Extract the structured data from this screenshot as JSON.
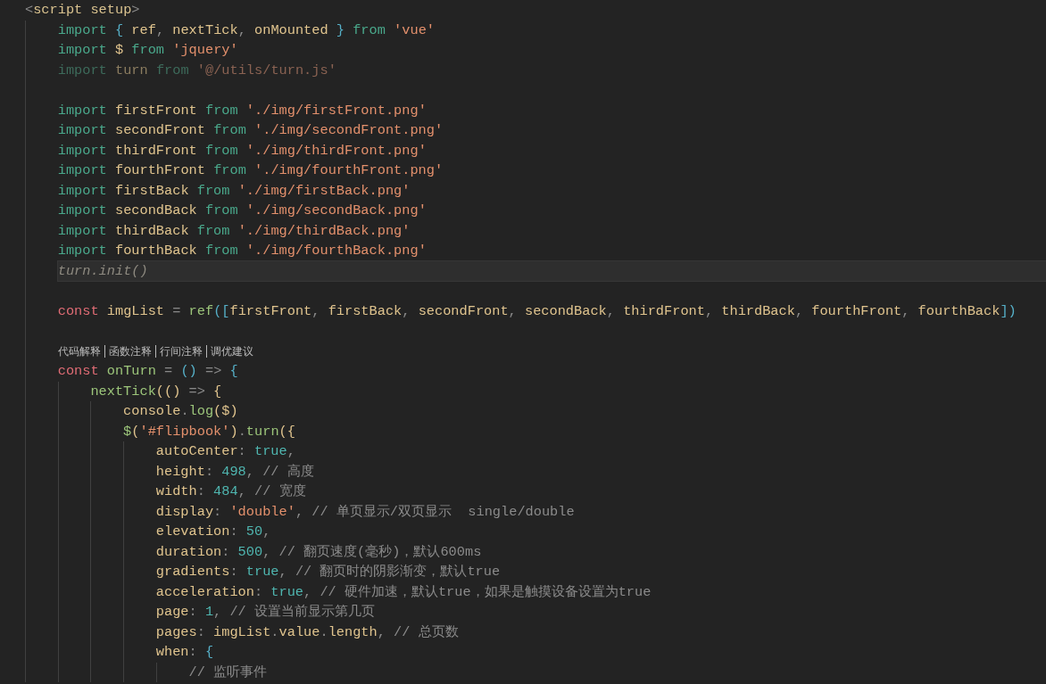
{
  "editor": {
    "lines": [
      {
        "kind": "code",
        "current": false,
        "tokens": [
          {
            "kind": "punct",
            "text": "<"
          },
          {
            "kind": "tag",
            "text": "script setup"
          },
          {
            "kind": "punct",
            "text": ">"
          }
        ],
        "children": [
          {
            "kind": "code",
            "current": false,
            "tokens": [
              {
                "kind": "keyword",
                "text": "import "
              },
              {
                "kind": "brace",
                "text": "{ "
              },
              {
                "kind": "ident",
                "text": "ref"
              },
              {
                "kind": "punct",
                "text": ", "
              },
              {
                "kind": "ident",
                "text": "nextTick"
              },
              {
                "kind": "punct",
                "text": ", "
              },
              {
                "kind": "ident",
                "text": "onMounted "
              },
              {
                "kind": "brace",
                "text": "} "
              },
              {
                "kind": "keyword",
                "text": "from "
              },
              {
                "kind": "string",
                "text": "'vue'"
              }
            ]
          },
          {
            "kind": "code",
            "current": false,
            "tokens": [
              {
                "kind": "keyword",
                "text": "import "
              },
              {
                "kind": "ident",
                "text": "$ "
              },
              {
                "kind": "keyword",
                "text": "from "
              },
              {
                "kind": "string",
                "text": "'jquery'"
              }
            ]
          },
          {
            "kind": "code",
            "current": false,
            "tokens": [
              {
                "kind": "keyword_faded",
                "text": "import "
              },
              {
                "kind": "ident_faded",
                "text": "turn "
              },
              {
                "kind": "keyword_faded",
                "text": "from "
              },
              {
                "kind": "string_faded",
                "text": "'@/utils/turn.js'"
              }
            ]
          },
          {
            "kind": "blank"
          },
          {
            "kind": "code",
            "current": false,
            "tokens": [
              {
                "kind": "keyword",
                "text": "import "
              },
              {
                "kind": "ident",
                "text": "firstFront "
              },
              {
                "kind": "keyword",
                "text": "from "
              },
              {
                "kind": "string",
                "text": "'./img/firstFront.png'"
              }
            ]
          },
          {
            "kind": "code",
            "current": false,
            "tokens": [
              {
                "kind": "keyword",
                "text": "import "
              },
              {
                "kind": "ident",
                "text": "secondFront "
              },
              {
                "kind": "keyword",
                "text": "from "
              },
              {
                "kind": "string",
                "text": "'./img/secondFront.png'"
              }
            ]
          },
          {
            "kind": "code",
            "current": false,
            "tokens": [
              {
                "kind": "keyword",
                "text": "import "
              },
              {
                "kind": "ident",
                "text": "thirdFront "
              },
              {
                "kind": "keyword",
                "text": "from "
              },
              {
                "kind": "string",
                "text": "'./img/thirdFront.png'"
              }
            ]
          },
          {
            "kind": "code",
            "current": false,
            "tokens": [
              {
                "kind": "keyword",
                "text": "import "
              },
              {
                "kind": "ident",
                "text": "fourthFront "
              },
              {
                "kind": "keyword",
                "text": "from "
              },
              {
                "kind": "string",
                "text": "'./img/fourthFront.png'"
              }
            ]
          },
          {
            "kind": "code",
            "current": false,
            "tokens": [
              {
                "kind": "keyword",
                "text": "import "
              },
              {
                "kind": "ident",
                "text": "firstBack "
              },
              {
                "kind": "keyword",
                "text": "from "
              },
              {
                "kind": "string",
                "text": "'./img/firstBack.png'"
              }
            ]
          },
          {
            "kind": "code",
            "current": false,
            "tokens": [
              {
                "kind": "keyword",
                "text": "import "
              },
              {
                "kind": "ident",
                "text": "secondBack "
              },
              {
                "kind": "keyword",
                "text": "from "
              },
              {
                "kind": "string",
                "text": "'./img/secondBack.png'"
              }
            ]
          },
          {
            "kind": "code",
            "current": false,
            "tokens": [
              {
                "kind": "keyword",
                "text": "import "
              },
              {
                "kind": "ident",
                "text": "thirdBack "
              },
              {
                "kind": "keyword",
                "text": "from "
              },
              {
                "kind": "string",
                "text": "'./img/thirdBack.png'"
              }
            ]
          },
          {
            "kind": "code",
            "current": false,
            "tokens": [
              {
                "kind": "keyword",
                "text": "import "
              },
              {
                "kind": "ident",
                "text": "fourthBack "
              },
              {
                "kind": "keyword",
                "text": "from "
              },
              {
                "kind": "string",
                "text": "'./img/fourthBack.png'"
              }
            ]
          },
          {
            "kind": "code",
            "current": true,
            "tokens": [
              {
                "kind": "italic",
                "text": "turn.init()"
              }
            ]
          },
          {
            "kind": "blank"
          },
          {
            "kind": "code",
            "current": false,
            "tokens": [
              {
                "kind": "storage",
                "text": "const "
              },
              {
                "kind": "ident",
                "text": "imgList "
              },
              {
                "kind": "punct",
                "text": "= "
              },
              {
                "kind": "function",
                "text": "ref"
              },
              {
                "kind": "brace",
                "text": "(["
              },
              {
                "kind": "ident",
                "text": "firstFront"
              },
              {
                "kind": "punct",
                "text": ", "
              },
              {
                "kind": "ident",
                "text": "firstBack"
              },
              {
                "kind": "punct",
                "text": ", "
              },
              {
                "kind": "ident",
                "text": "secondFront"
              },
              {
                "kind": "punct",
                "text": ", "
              },
              {
                "kind": "ident",
                "text": "secondBack"
              },
              {
                "kind": "punct",
                "text": ", "
              },
              {
                "kind": "ident",
                "text": "thirdFront"
              },
              {
                "kind": "punct",
                "text": ", "
              },
              {
                "kind": "ident",
                "text": "thirdBack"
              },
              {
                "kind": "punct",
                "text": ", "
              },
              {
                "kind": "ident",
                "text": "fourthFront"
              },
              {
                "kind": "punct",
                "text": ", "
              },
              {
                "kind": "ident",
                "text": "fourthBack"
              },
              {
                "kind": "brace",
                "text": "])"
              }
            ]
          },
          {
            "kind": "blank"
          },
          {
            "kind": "codelens",
            "links": [
              "代码解释",
              "函数注释",
              "行间注释",
              "调优建议"
            ]
          },
          {
            "kind": "code",
            "current": false,
            "tokens": [
              {
                "kind": "storage",
                "text": "const "
              },
              {
                "kind": "function",
                "text": "onTurn "
              },
              {
                "kind": "punct",
                "text": "= "
              },
              {
                "kind": "brace",
                "text": "() "
              },
              {
                "kind": "punct",
                "text": "=> "
              },
              {
                "kind": "brace",
                "text": "{"
              }
            ],
            "children": [
              {
                "kind": "code",
                "current": false,
                "tokens": [
                  {
                    "kind": "function",
                    "text": "nextTick"
                  },
                  {
                    "kind": "paren",
                    "text": "(() "
                  },
                  {
                    "kind": "punct",
                    "text": "=> "
                  },
                  {
                    "kind": "paren",
                    "text": "{"
                  }
                ],
                "children": [
                  {
                    "kind": "code",
                    "current": false,
                    "tokens": [
                      {
                        "kind": "ident",
                        "text": "console"
                      },
                      {
                        "kind": "punct",
                        "text": "."
                      },
                      {
                        "kind": "function",
                        "text": "log"
                      },
                      {
                        "kind": "paren",
                        "text": "($)"
                      }
                    ]
                  },
                  {
                    "kind": "code",
                    "current": false,
                    "tokens": [
                      {
                        "kind": "function",
                        "text": "$"
                      },
                      {
                        "kind": "paren",
                        "text": "("
                      },
                      {
                        "kind": "string",
                        "text": "'#flipbook'"
                      },
                      {
                        "kind": "paren",
                        "text": ")"
                      },
                      {
                        "kind": "punct",
                        "text": "."
                      },
                      {
                        "kind": "function",
                        "text": "turn"
                      },
                      {
                        "kind": "paren",
                        "text": "({"
                      }
                    ],
                    "children": [
                      {
                        "kind": "code",
                        "current": false,
                        "tokens": [
                          {
                            "kind": "property",
                            "text": "autoCenter"
                          },
                          {
                            "kind": "punct",
                            "text": ": "
                          },
                          {
                            "kind": "constant",
                            "text": "true"
                          },
                          {
                            "kind": "punct",
                            "text": ","
                          }
                        ]
                      },
                      {
                        "kind": "code",
                        "current": false,
                        "tokens": [
                          {
                            "kind": "property",
                            "text": "height"
                          },
                          {
                            "kind": "punct",
                            "text": ": "
                          },
                          {
                            "kind": "constant",
                            "text": "498"
                          },
                          {
                            "kind": "punct",
                            "text": ", "
                          },
                          {
                            "kind": "comment",
                            "text": "// 高度"
                          }
                        ]
                      },
                      {
                        "kind": "code",
                        "current": false,
                        "tokens": [
                          {
                            "kind": "property",
                            "text": "width"
                          },
                          {
                            "kind": "punct",
                            "text": ": "
                          },
                          {
                            "kind": "constant",
                            "text": "484"
                          },
                          {
                            "kind": "punct",
                            "text": ", "
                          },
                          {
                            "kind": "comment",
                            "text": "// 宽度"
                          }
                        ]
                      },
                      {
                        "kind": "code",
                        "current": false,
                        "tokens": [
                          {
                            "kind": "property",
                            "text": "display"
                          },
                          {
                            "kind": "punct",
                            "text": ": "
                          },
                          {
                            "kind": "string",
                            "text": "'double'"
                          },
                          {
                            "kind": "punct",
                            "text": ", "
                          },
                          {
                            "kind": "comment",
                            "text": "// 单页显示/双页显示  single/double"
                          }
                        ]
                      },
                      {
                        "kind": "code",
                        "current": false,
                        "tokens": [
                          {
                            "kind": "property",
                            "text": "elevation"
                          },
                          {
                            "kind": "punct",
                            "text": ": "
                          },
                          {
                            "kind": "constant",
                            "text": "50"
                          },
                          {
                            "kind": "punct",
                            "text": ","
                          }
                        ]
                      },
                      {
                        "kind": "code",
                        "current": false,
                        "tokens": [
                          {
                            "kind": "property",
                            "text": "duration"
                          },
                          {
                            "kind": "punct",
                            "text": ": "
                          },
                          {
                            "kind": "constant",
                            "text": "500"
                          },
                          {
                            "kind": "punct",
                            "text": ", "
                          },
                          {
                            "kind": "comment",
                            "text": "// 翻页速度(毫秒)，默认600ms"
                          }
                        ]
                      },
                      {
                        "kind": "code",
                        "current": false,
                        "tokens": [
                          {
                            "kind": "property",
                            "text": "gradients"
                          },
                          {
                            "kind": "punct",
                            "text": ": "
                          },
                          {
                            "kind": "constant",
                            "text": "true"
                          },
                          {
                            "kind": "punct",
                            "text": ", "
                          },
                          {
                            "kind": "comment",
                            "text": "// 翻页时的阴影渐变，默认true"
                          }
                        ]
                      },
                      {
                        "kind": "code",
                        "current": false,
                        "tokens": [
                          {
                            "kind": "property",
                            "text": "acceleration"
                          },
                          {
                            "kind": "punct",
                            "text": ": "
                          },
                          {
                            "kind": "constant",
                            "text": "true"
                          },
                          {
                            "kind": "punct",
                            "text": ", "
                          },
                          {
                            "kind": "comment",
                            "text": "// 硬件加速，默认true，如果是触摸设备设置为true"
                          }
                        ]
                      },
                      {
                        "kind": "code",
                        "current": false,
                        "tokens": [
                          {
                            "kind": "property",
                            "text": "page"
                          },
                          {
                            "kind": "punct",
                            "text": ": "
                          },
                          {
                            "kind": "constant",
                            "text": "1"
                          },
                          {
                            "kind": "punct",
                            "text": ", "
                          },
                          {
                            "kind": "comment",
                            "text": "// 设置当前显示第几页"
                          }
                        ]
                      },
                      {
                        "kind": "code",
                        "current": false,
                        "tokens": [
                          {
                            "kind": "property",
                            "text": "pages"
                          },
                          {
                            "kind": "punct",
                            "text": ": "
                          },
                          {
                            "kind": "ident",
                            "text": "imgList"
                          },
                          {
                            "kind": "punct",
                            "text": "."
                          },
                          {
                            "kind": "property",
                            "text": "value"
                          },
                          {
                            "kind": "punct",
                            "text": "."
                          },
                          {
                            "kind": "property",
                            "text": "length"
                          },
                          {
                            "kind": "punct",
                            "text": ", "
                          },
                          {
                            "kind": "comment",
                            "text": "// 总页数"
                          }
                        ]
                      },
                      {
                        "kind": "code",
                        "current": false,
                        "tokens": [
                          {
                            "kind": "property",
                            "text": "when"
                          },
                          {
                            "kind": "punct",
                            "text": ": "
                          },
                          {
                            "kind": "brace",
                            "text": "{"
                          }
                        ],
                        "children": [
                          {
                            "kind": "code",
                            "current": false,
                            "tokens": [
                              {
                                "kind": "comment",
                                "text": "// 监听事件"
                              }
                            ]
                          }
                        ]
                      }
                    ]
                  }
                ]
              }
            ]
          }
        ]
      }
    ]
  }
}
